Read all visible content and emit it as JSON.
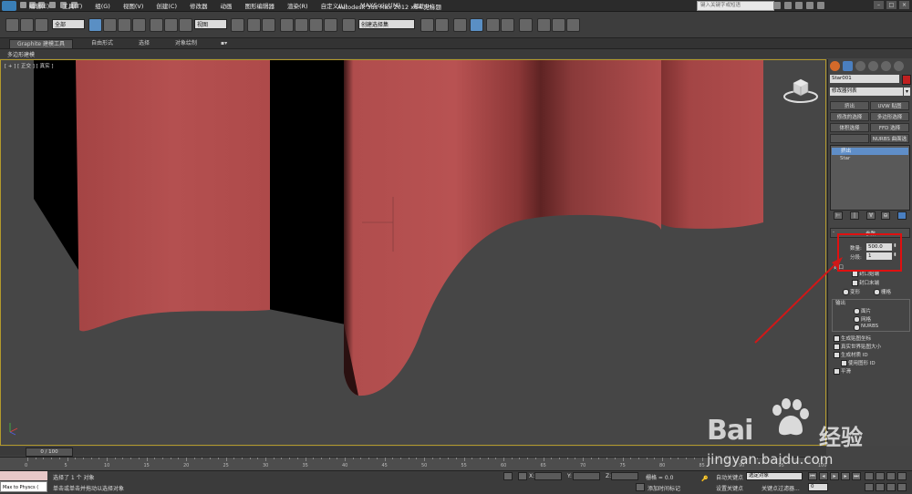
{
  "app": {
    "title": "Autodesk 3ds Max 2012 x64    无标题",
    "menus": [
      "编辑(E)",
      "工具(T)",
      "组(G)",
      "视图(V)",
      "创建(C)",
      "修改器",
      "动画",
      "图形编辑器",
      "渲染(R)",
      "自定义(U)",
      "MAXScript(M)",
      "帮助(H)"
    ],
    "search_placeholder": "键入关键字或短语"
  },
  "toolbar": {
    "selection_filter": "全部",
    "coord_system": "视图",
    "named_selection": "创建选择集"
  },
  "ribbon": {
    "tabs": [
      "Graphite 建模工具",
      "自由形式",
      "选择",
      "对象绘制"
    ],
    "subtab": "多边形建模"
  },
  "viewport": {
    "label": "[ + ] [ 正交 ] [ 真实 ]"
  },
  "command_panel": {
    "object_name": "Star001",
    "modifier_list": "修改器列表",
    "modifier_buttons": [
      "挤出",
      "UVW 贴图",
      "修改的选择",
      "多边形选择",
      "体积选择",
      "FFD 选择",
      "",
      "NURBS 曲面选择"
    ],
    "stack": {
      "selected": "挤出",
      "base": "Star"
    },
    "rollout_title": "参数",
    "amount_label": "数量:",
    "amount_value": "500.0",
    "segments_label": "分段:",
    "segments_value": "1",
    "capping_title": "封口",
    "cap_start": "封口始端",
    "cap_end": "封口末端",
    "morph": "变形",
    "grid": "栅格",
    "output_title": "输出",
    "output_options": [
      "面片",
      "网格",
      "NURBS"
    ],
    "gen_mapping": "生成贴图坐标",
    "real_world": "真实世界贴图大小",
    "gen_material_ids": "生成材质 ID",
    "use_shape_ids": "使用图形 ID",
    "smooth": "平滑"
  },
  "timeline": {
    "slider": "0 / 100",
    "ticks": [
      "0",
      "5",
      "10",
      "15",
      "20",
      "25",
      "30",
      "35",
      "40",
      "45",
      "50",
      "55",
      "60",
      "65",
      "70",
      "75",
      "80",
      "85",
      "90",
      "95",
      "100"
    ]
  },
  "status": {
    "selected": "选择了 1 个 对象",
    "prompt": "单击或单击并拖动以选择对象",
    "maxscript": "Max to Physcs (",
    "x_label": "X:",
    "y_label": "Y:",
    "z_label": "Z:",
    "grid": "栅格 = 0.0",
    "add_time_tag": "添加时间标记",
    "auto_key": "自动关键点",
    "set_key": "设置关键点",
    "selected_obj": "选定对象",
    "key_filters": "关键点过滤器...",
    "frame_value": "0"
  },
  "watermark": {
    "brand": "Bai",
    "cn": "经验",
    "url": "jingyan.baidu.com"
  },
  "colors": {
    "object_red": "#b04848",
    "selection_border": "#b39a2c",
    "highlight_box": "#e01010",
    "arrow": "#d01818"
  }
}
